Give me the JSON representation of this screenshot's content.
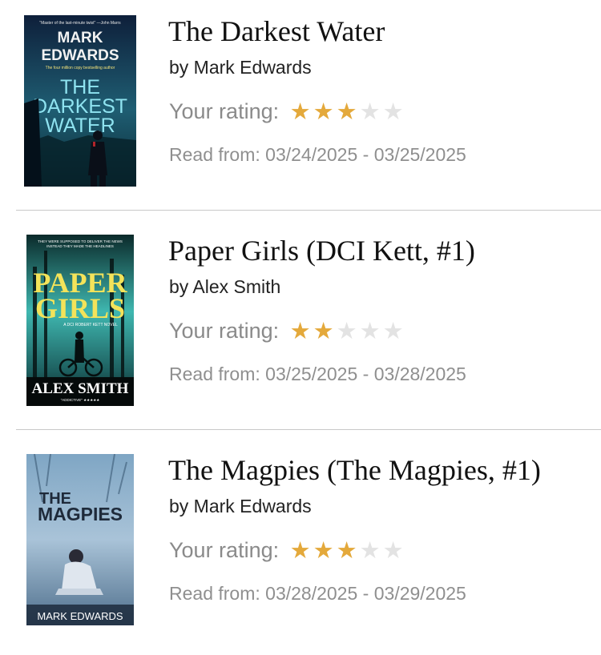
{
  "rating_label": "Your rating:",
  "read_label": "Read from:",
  "colors": {
    "star_filled": "#e4a93b",
    "star_empty": "#e3e3e3",
    "label_grey": "#8a8a8a"
  },
  "books": [
    {
      "title": "The Darkest Water",
      "author": "by Mark Edwards",
      "rating": 3,
      "max_rating": 5,
      "read_from": "03/24/2025",
      "read_to": "03/25/2025",
      "cover": {
        "tagline": "\"Master of the last-minute twist\" —John Marrs",
        "author_line1": "MARK",
        "author_line2": "EDWARDS",
        "subline": "The four million copy bestselling author",
        "title_line1": "THE",
        "title_line2": "DARKEST",
        "title_line3": "WATER"
      }
    },
    {
      "title": "Paper Girls (DCI Kett, #1)",
      "author": "by Alex Smith",
      "rating": 2,
      "max_rating": 5,
      "read_from": "03/25/2025",
      "read_to": "03/28/2025",
      "cover": {
        "tagline1": "THEY WERE SUPPOSED TO DELIVER THE NEWS",
        "tagline2": "INSTEAD THEY MADE THE HEADLINES",
        "title_line1": "PAPER",
        "title_line2": "GIRLS",
        "series": "A DCI ROBERT KETT NOVEL",
        "author": "ALEX SMITH",
        "blurb": "\"ADDICTIVE\" ★★★★★"
      }
    },
    {
      "title": "The Magpies (The Magpies, #1)",
      "author": "by Mark Edwards",
      "rating": 3,
      "max_rating": 5,
      "read_from": "03/28/2025",
      "read_to": "03/29/2025",
      "cover": {
        "title_line1": "THE",
        "title_line2": "MAGPIES",
        "author": "MARK EDWARDS"
      }
    }
  ]
}
